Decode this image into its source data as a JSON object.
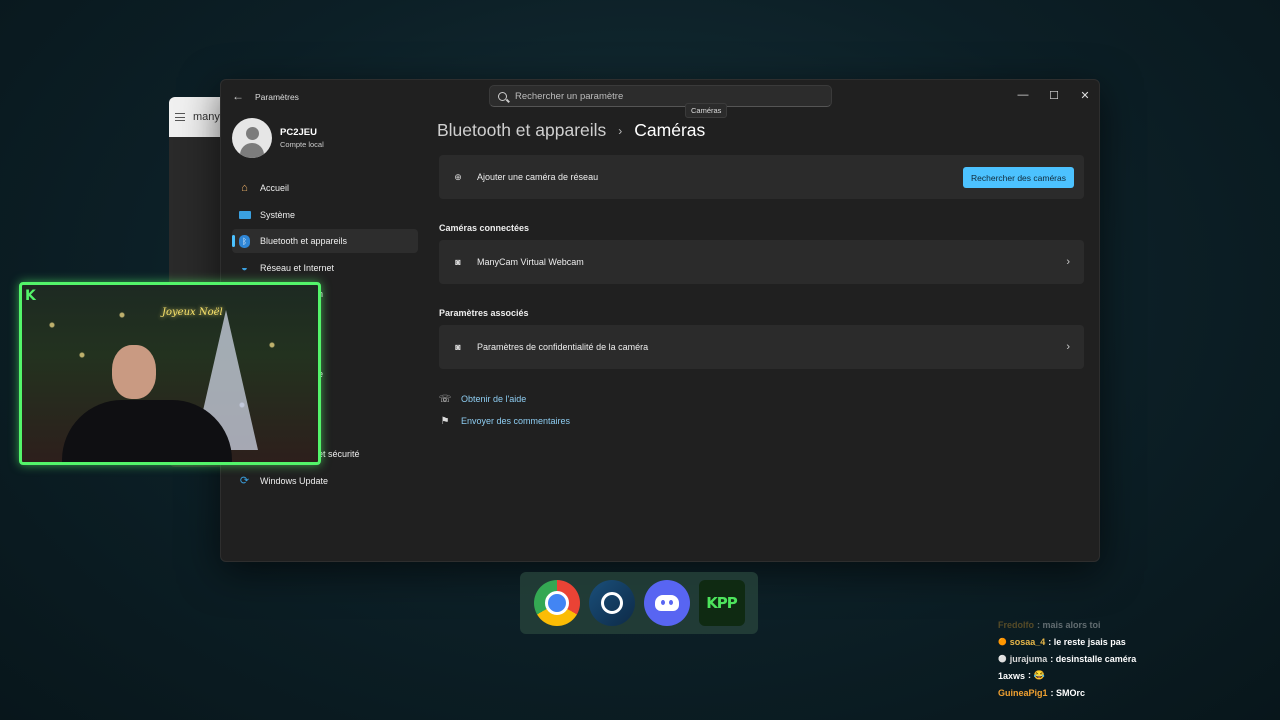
{
  "bg_window": {
    "title_fragment": "many"
  },
  "window": {
    "app_title": "Paramètres",
    "search_placeholder": "Rechercher un paramètre",
    "tooltip": "Caméras",
    "controls": {
      "minimize": "—",
      "maximize": "☐",
      "close": "✕"
    }
  },
  "profile": {
    "name": "PC2JEU",
    "account_type": "Compte local"
  },
  "sidebar": {
    "items": [
      {
        "label": "Accueil",
        "icon": "home-icon"
      },
      {
        "label": "Système",
        "icon": "monitor-icon"
      },
      {
        "label": "Bluetooth et appareils",
        "icon": "bluetooth-icon",
        "active": true
      },
      {
        "label": "Réseau et Internet",
        "icon": "wifi-icon"
      },
      {
        "label": "n",
        "icon": "personalization-icon"
      },
      {
        "label": "",
        "icon": "apps-icon"
      },
      {
        "label": "",
        "icon": "accounts-icon"
      },
      {
        "label": "e",
        "icon": "time-language-icon"
      },
      {
        "label": "",
        "icon": "gaming-icon"
      },
      {
        "label": "",
        "icon": "accessibility-icon"
      },
      {
        "label": "et sécurité",
        "icon": "privacy-icon"
      },
      {
        "label": "Windows Update",
        "icon": "update-icon"
      }
    ]
  },
  "breadcrumb": {
    "parent": "Bluetooth et appareils",
    "separator": "›",
    "current": "Caméras"
  },
  "add_camera": {
    "label": "Ajouter une caméra de réseau",
    "button": "Rechercher des caméras"
  },
  "connected": {
    "title": "Caméras connectées",
    "devices": [
      {
        "name": "ManyCam Virtual Webcam"
      }
    ]
  },
  "related": {
    "title": "Paramètres associés",
    "items": [
      {
        "label": "Paramètres de confidentialité de la caméra"
      }
    ]
  },
  "links": {
    "help": "Obtenir de l'aide",
    "feedback": "Envoyer des commentaires"
  },
  "webcam": {
    "logo": "K",
    "sign": "Joyeux Noël"
  },
  "dock": {
    "apps": [
      {
        "name": "Chrome",
        "icon": "chrome-icon"
      },
      {
        "name": "Steam",
        "icon": "steam-icon"
      },
      {
        "name": "Discord",
        "icon": "discord-icon"
      },
      {
        "name": "KPP",
        "label": "KPP",
        "icon": "kpp-icon"
      }
    ]
  },
  "chat": {
    "messages": [
      {
        "user": "Fredolfo",
        "text": ": mais alors toi",
        "color": "#e0a030",
        "faded": true,
        "badge": ""
      },
      {
        "user": "sosaa_4",
        "text": ": le reste jsais pas",
        "color": "#e8b84a",
        "badge": "🟠"
      },
      {
        "user": "jurajuma",
        "text": ": desinstalle caméra",
        "color": "#d9d9d9",
        "badge": "⚪"
      },
      {
        "user": "1axws",
        "text": ": 😂",
        "color": "#ffffff",
        "badge": ""
      },
      {
        "user": "GuineaPig1",
        "text": ": SMOrc",
        "color": "#f0a030",
        "badge": ""
      }
    ]
  }
}
